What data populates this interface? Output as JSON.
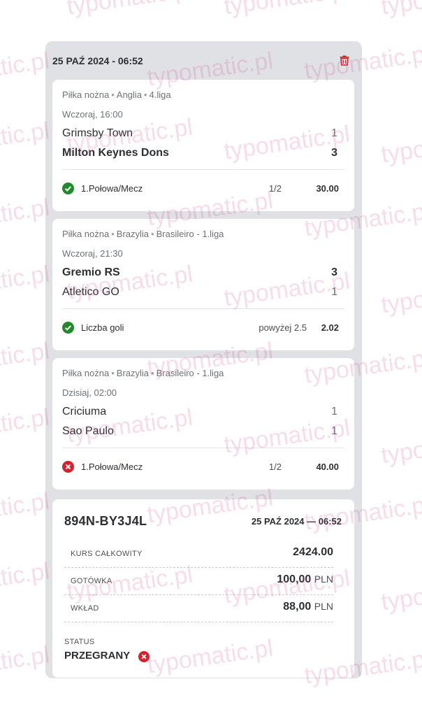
{
  "ticket": {
    "date": "25 PAŹ 2024 - 06:52",
    "accent_color": "#d9212c"
  },
  "bets": [
    {
      "sport": "Piłka nożna",
      "country": "Anglia",
      "league": "4.liga",
      "time": "Wczoraj, 16:00",
      "home": "Grimsby Town",
      "home_score": "1",
      "away": "Milton Keynes Dons",
      "away_score": "3",
      "market": "1.Połowa/Mecz",
      "pick": "1/2",
      "odds": "30.00",
      "status_icon": "check-icon"
    },
    {
      "sport": "Piłka nożna",
      "country": "Brazylia",
      "league": "Brasileiro - 1.liga",
      "time": "Wczoraj, 21:30",
      "home": "Gremio RS",
      "home_score": "3",
      "away": "Atletico GO",
      "away_score": "1",
      "market": "Liczba goli",
      "pick": "powyżej 2.5",
      "odds": "2.02",
      "status_icon": "check-icon"
    },
    {
      "sport": "Piłka nożna",
      "country": "Brazylia",
      "league": "Brasileiro - 1.liga",
      "time": "Dzisiaj, 02:00",
      "home": "Criciuma",
      "home_score": "1",
      "away": "Sao Paulo",
      "away_score": "1",
      "market": "1.Połowa/Mecz",
      "pick": "1/2",
      "odds": "40.00",
      "status_icon": "cross-icon"
    }
  ],
  "summary": {
    "code": "894N-BY3J4L",
    "date": "25 PAŹ 2024 — 06:52",
    "total_odds_label": "KURS CAŁKOWITY",
    "total_odds": "2424.00",
    "cash_label": "GOTÓWKA",
    "cash": "100,00",
    "stake_label": "WKŁAD",
    "stake": "88,00",
    "currency": "PLN",
    "status_label": "STATUS",
    "status": "PRZEGRANY"
  },
  "watermark": "typomatic.pl"
}
